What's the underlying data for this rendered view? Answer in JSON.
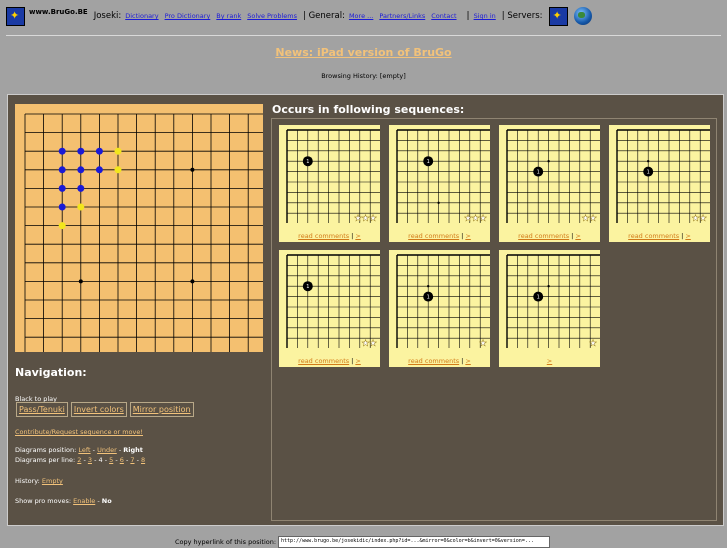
{
  "topbar": {
    "site": "www.BruGo.BE",
    "joseki_label": "Joseki:",
    "joseki_links": [
      "Dictionary",
      "Pro Dictionary",
      "By rank",
      "Solve Problems"
    ],
    "general_label": "| General:",
    "general_links": [
      "More ...",
      "Partners/Links",
      "Contact"
    ],
    "pipe": "|",
    "signin": "Sign in",
    "servers_label": "| Servers:"
  },
  "news": "News: iPad version of BruGo",
  "history": "Browsing History: [empty]",
  "board": {
    "size": 19,
    "blue_stones": [
      [
        2,
        2
      ],
      [
        3,
        2
      ],
      [
        4,
        2
      ],
      [
        2,
        3
      ],
      [
        3,
        3
      ],
      [
        4,
        3
      ],
      [
        2,
        4
      ],
      [
        3,
        4
      ],
      [
        2,
        5
      ]
    ],
    "yellow_stones": [
      [
        5,
        2
      ],
      [
        5,
        3
      ],
      [
        3,
        5
      ],
      [
        2,
        6
      ]
    ],
    "hoshi": [
      [
        3,
        3
      ],
      [
        9,
        3
      ],
      [
        15,
        3
      ],
      [
        3,
        9
      ],
      [
        9,
        9
      ],
      [
        15,
        9
      ],
      [
        3,
        15
      ],
      [
        9,
        15
      ],
      [
        15,
        15
      ]
    ]
  },
  "navigation": {
    "title": "Navigation:",
    "to_play": "Black to play",
    "buttons": [
      "Pass/Tenuki",
      "Invert colors",
      "Mirror position"
    ],
    "contribute": "Contribute/Request sequence or move!",
    "diag_pos_label": "Diagrams position:",
    "diag_pos_left": "Left",
    "diag_pos_under": "Under",
    "diag_pos_right": "Right",
    "diag_per_line_label": "Diagrams per line:",
    "diag_per_line": [
      "2",
      "3",
      "4",
      "5",
      "6",
      "7",
      "8"
    ],
    "history_label": "History:",
    "history_value": "Empty",
    "pro_label": "Show pro moves:",
    "pro_enable": "Enable",
    "pro_no": "No"
  },
  "sequences": {
    "title": "Occurs in following sequences:",
    "read_comments": "read comments",
    "more": ">",
    "cards": [
      {
        "stone": [
          2,
          3
        ],
        "dot": null,
        "stars": 3,
        "comments": true
      },
      {
        "stone": [
          3,
          3
        ],
        "dot": [
          4,
          7
        ],
        "stars": 3,
        "comments": true
      },
      {
        "stone": [
          3,
          4
        ],
        "dot": [
          4,
          3
        ],
        "stars": 2,
        "comments": true
      },
      {
        "stone": [
          3,
          4
        ],
        "dot": [
          3,
          3
        ],
        "stars": 2,
        "comments": true
      },
      {
        "stone": [
          2,
          3
        ],
        "dot": null,
        "stars": 2,
        "comments": true
      },
      {
        "stone": [
          3,
          4
        ],
        "dot": [
          3,
          3
        ],
        "stars": 1,
        "comments": true
      },
      {
        "stone": [
          3,
          4
        ],
        "dot": [
          4,
          3
        ],
        "stars": 1,
        "comments": false
      }
    ]
  },
  "copy": {
    "label": "Copy hyperlink of this position:",
    "url": "http://www.brugo.be/josekidic/index.php?id=...&mirror=0&color=b&invert=0&version=..."
  }
}
